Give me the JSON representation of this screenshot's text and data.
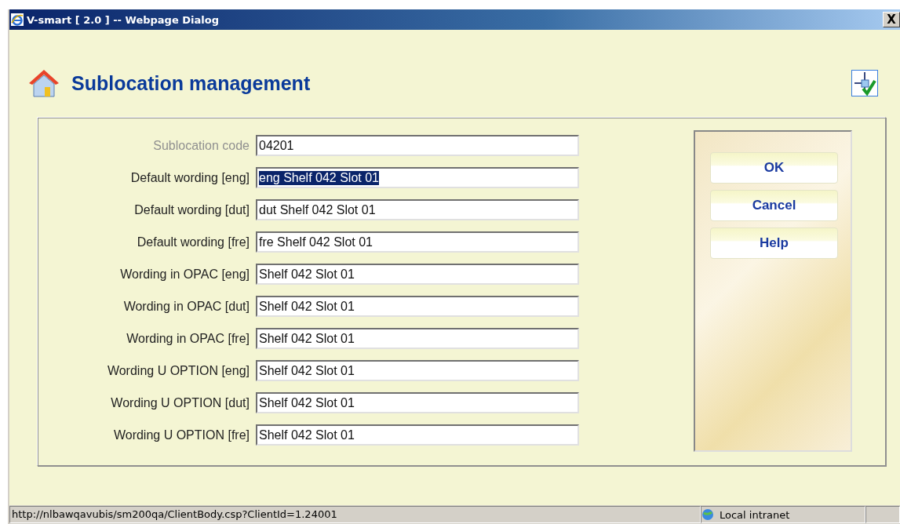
{
  "window": {
    "title": "V-smart [ 2.0 ] -- Webpage Dialog",
    "close": "X"
  },
  "heading": "Sublocation management",
  "fields": [
    {
      "label": "Sublocation code",
      "value": "04201",
      "disabled": true,
      "highlighted": false
    },
    {
      "label": "Default wording [eng]",
      "value": "eng Shelf 042 Slot 01",
      "disabled": false,
      "highlighted": true
    },
    {
      "label": "Default wording [dut]",
      "value": "dut Shelf 042 Slot 01",
      "disabled": false,
      "highlighted": false
    },
    {
      "label": "Default wording [fre]",
      "value": "fre Shelf 042 Slot 01",
      "disabled": false,
      "highlighted": false
    },
    {
      "label": "Wording in OPAC [eng]",
      "value": "Shelf 042 Slot 01",
      "disabled": false,
      "highlighted": false
    },
    {
      "label": "Wording in OPAC [dut]",
      "value": "Shelf 042 Slot 01",
      "disabled": false,
      "highlighted": false
    },
    {
      "label": "Wording in OPAC [fre]",
      "value": "Shelf 042 Slot 01",
      "disabled": false,
      "highlighted": false
    },
    {
      "label": "Wording U OPTION [eng]",
      "value": "Shelf 042 Slot 01",
      "disabled": false,
      "highlighted": false
    },
    {
      "label": "Wording U OPTION [dut]",
      "value": "Shelf 042 Slot 01",
      "disabled": false,
      "highlighted": false
    },
    {
      "label": "Wording U OPTION [fre]",
      "value": "Shelf 042 Slot 01",
      "disabled": false,
      "highlighted": false
    }
  ],
  "buttons": [
    "OK",
    "Cancel",
    "Help"
  ],
  "status_bar": {
    "url": "http://nlbawqavubis/sm200qa/ClientBody.csp?ClientId=1.24001",
    "zone": "Local intranet"
  }
}
